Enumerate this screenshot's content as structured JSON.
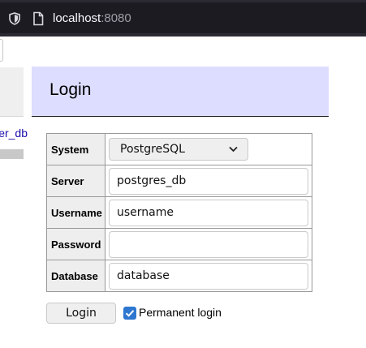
{
  "browser": {
    "host": "localhost",
    "port": ":8080"
  },
  "sidebar": {
    "link_text": "er_db"
  },
  "login": {
    "title": "Login",
    "fields": {
      "system": {
        "label": "System",
        "value": "PostgreSQL"
      },
      "server": {
        "label": "Server",
        "value": "postgres_db"
      },
      "username": {
        "label": "Username",
        "value": "username"
      },
      "password": {
        "label": "Password",
        "value": ""
      },
      "database": {
        "label": "Database",
        "value": "database"
      }
    },
    "submit_label": "Login",
    "permanent_label": "Permanent login",
    "permanent_checked": true
  },
  "colors": {
    "header_bg": "#ddddff",
    "checkbox": "#2e77d0",
    "chrome": "#1c1b22"
  },
  "icons": [
    "shield-icon",
    "page-icon",
    "chevron-down-icon",
    "checkmark-icon"
  ]
}
